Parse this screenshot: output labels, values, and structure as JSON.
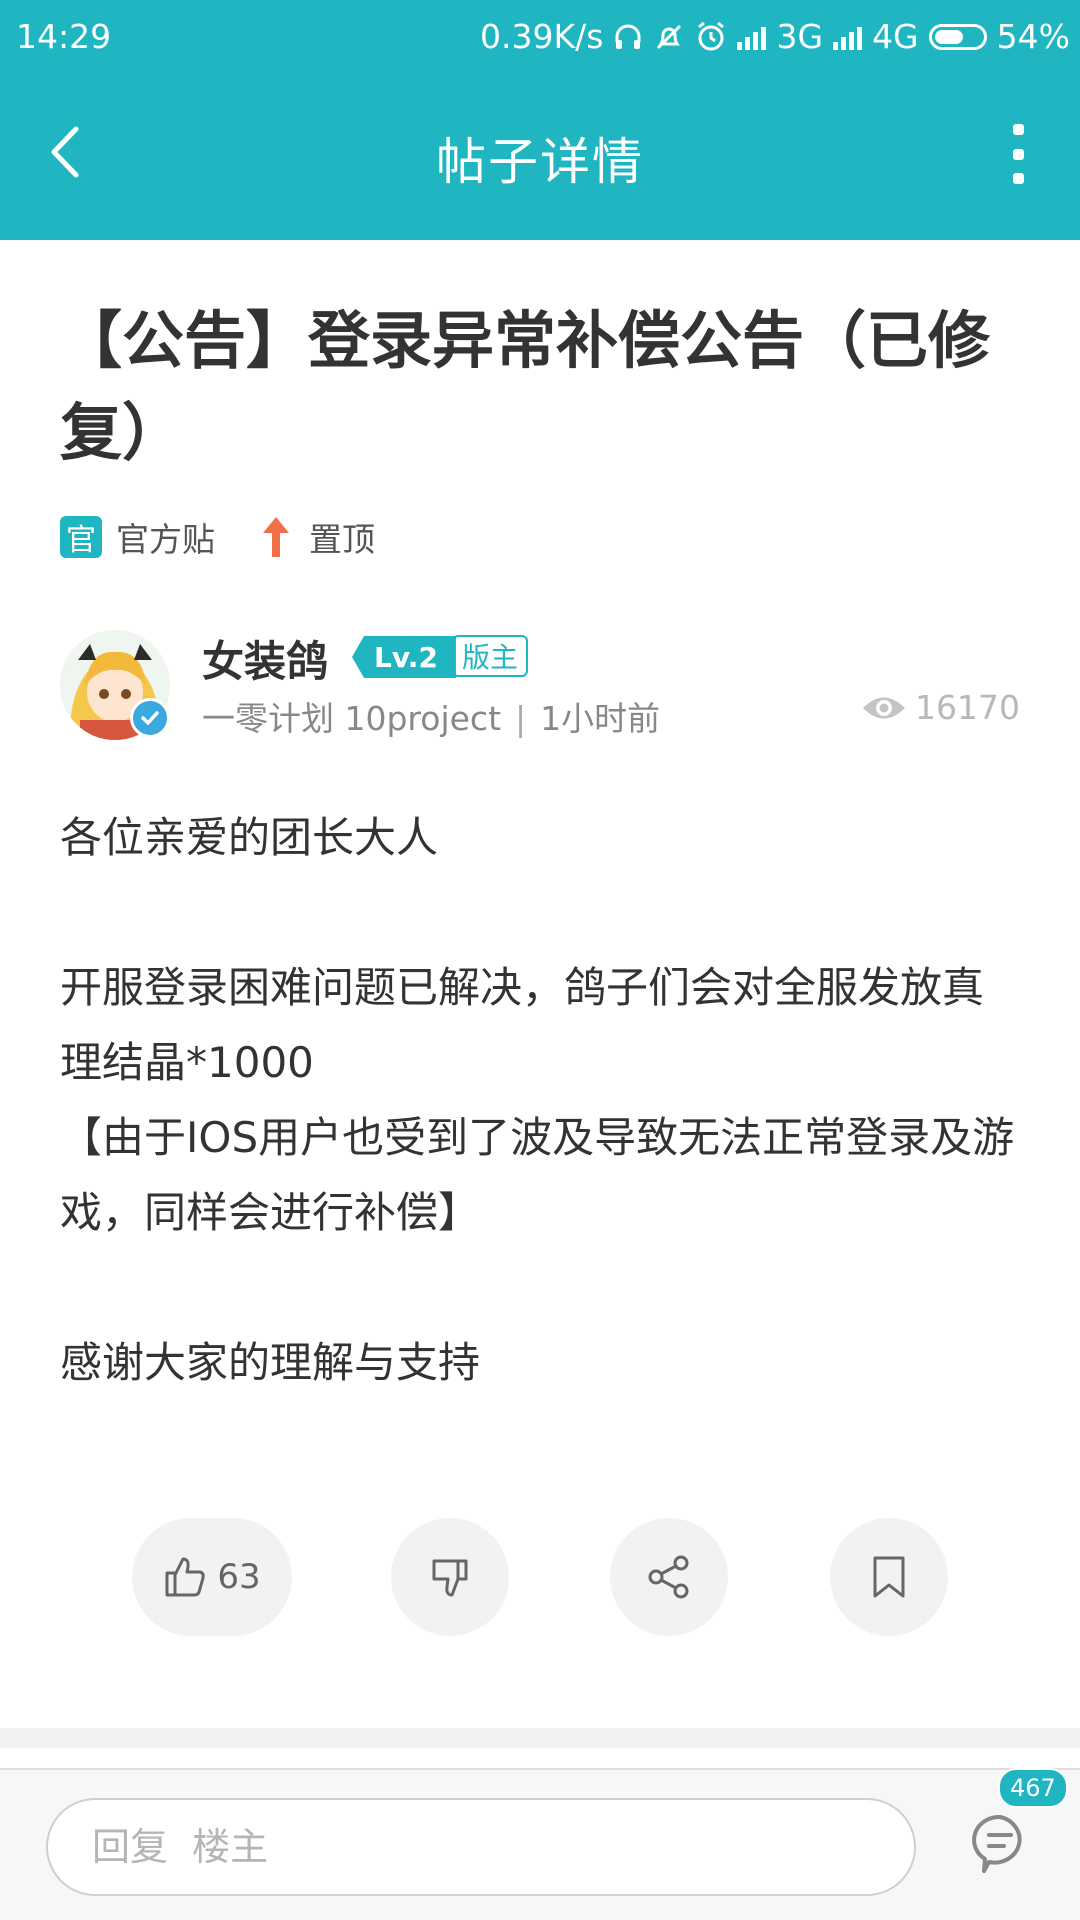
{
  "status_bar": {
    "time": "14:29",
    "net_speed": "0.39K/s",
    "sim1": "3G",
    "sim2": "4G",
    "battery": "54%",
    "icons": [
      "headphones-icon",
      "bell-off-icon",
      "alarm-icon",
      "signal-icon",
      "battery-icon"
    ]
  },
  "toolbar": {
    "title": "帖子详情",
    "back_icon": "chevron-left-icon",
    "more_icon": "more-vertical-icon"
  },
  "post": {
    "title": "【公告】登录异常补偿公告（已修复）",
    "tags": {
      "official_icon": "官",
      "official": "官方贴",
      "pinned": "置顶",
      "pin_icon": "arrow-up-icon"
    },
    "author": {
      "name": "女装鸽",
      "level": "Lv.2",
      "role": "版主",
      "forum": "一零计划 10project",
      "separator": "|",
      "time": "1小时前",
      "views": "16170"
    },
    "body": {
      "line1": "各位亲爱的团长大人",
      "line2": "开服登录困难问题已解决，鸽子们会对全服发放真理结晶*1000",
      "line3": "【由于IOS用户也受到了波及导致无法正常登录及游戏，同样会进行补偿】",
      "line4": "感谢大家的理解与支持"
    }
  },
  "actions": {
    "like_count": "63",
    "icons": [
      "thumbs-up-icon",
      "thumbs-down-icon",
      "share-icon",
      "bookmark-icon"
    ]
  },
  "reply_bar": {
    "placeholder": "回复  楼主",
    "comment_count": "467"
  },
  "colors": {
    "accent": "#1fb6c1",
    "text": "#333333",
    "muted": "#888888"
  }
}
